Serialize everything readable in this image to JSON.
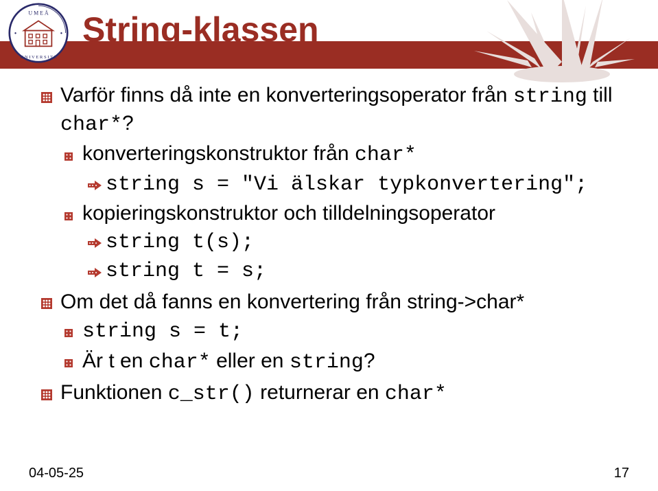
{
  "slide": {
    "title": "String-klassen",
    "bullets": [
      {
        "parts": [
          {
            "t": "Varför finns då inte en konverteringsoperator från ",
            "m": false
          },
          {
            "t": "string",
            "m": true
          },
          {
            "t": " till ",
            "m": false
          },
          {
            "t": "char*",
            "m": true
          },
          {
            "t": "?",
            "m": false
          }
        ],
        "children": [
          {
            "parts": [
              {
                "t": "konverteringskonstruktor från ",
                "m": false
              },
              {
                "t": "char*",
                "m": true
              }
            ],
            "children": [
              {
                "parts": [
                  {
                    "t": "string s = \"Vi älskar typkonvertering\";",
                    "m": true
                  }
                ]
              }
            ]
          },
          {
            "parts": [
              {
                "t": "kopieringskonstruktor och tilldelningsoperator",
                "m": false
              }
            ],
            "children": [
              {
                "parts": [
                  {
                    "t": "string t(s);",
                    "m": true
                  }
                ]
              },
              {
                "parts": [
                  {
                    "t": "string t = s;",
                    "m": true
                  }
                ]
              }
            ]
          }
        ]
      },
      {
        "parts": [
          {
            "t": "Om det då fanns en konvertering från string->char*",
            "m": false
          }
        ],
        "children": [
          {
            "parts": [
              {
                "t": "string s = t;",
                "m": true
              }
            ]
          },
          {
            "parts": [
              {
                "t": "Är t en ",
                "m": false
              },
              {
                "t": "char*",
                "m": true
              },
              {
                "t": " eller en ",
                "m": false
              },
              {
                "t": "string",
                "m": true
              },
              {
                "t": "?",
                "m": false
              }
            ]
          }
        ]
      },
      {
        "parts": [
          {
            "t": "Funktionen ",
            "m": false
          },
          {
            "t": "c_str()",
            "m": true
          },
          {
            "t": " returnerar en ",
            "m": false
          },
          {
            "t": "char*",
            "m": true
          }
        ]
      }
    ]
  },
  "footer": {
    "date": "04-05-25",
    "page": "17"
  }
}
